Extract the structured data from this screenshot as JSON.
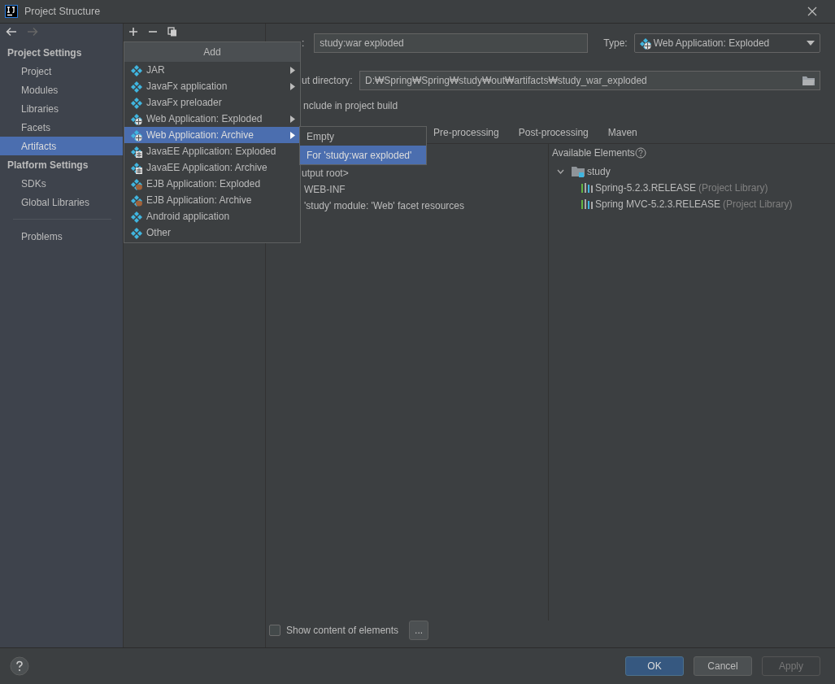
{
  "window": {
    "title": "Project Structure"
  },
  "sidebar": {
    "sections": [
      {
        "title": "Project Settings",
        "items": [
          {
            "label": "Project",
            "selected": false
          },
          {
            "label": "Modules",
            "selected": false
          },
          {
            "label": "Libraries",
            "selected": false
          },
          {
            "label": "Facets",
            "selected": false
          },
          {
            "label": "Artifacts",
            "selected": true
          }
        ]
      },
      {
        "title": "Platform Settings",
        "items": [
          {
            "label": "SDKs",
            "selected": false
          },
          {
            "label": "Global Libraries",
            "selected": false
          }
        ]
      }
    ],
    "bottom_items": [
      {
        "label": "Problems",
        "selected": false
      }
    ]
  },
  "add_menu": {
    "title": "Add",
    "items": [
      {
        "label": "JAR",
        "kind": "module",
        "submenu": true,
        "selected": false
      },
      {
        "label": "JavaFx application",
        "kind": "module",
        "submenu": true,
        "selected": false
      },
      {
        "label": "JavaFx preloader",
        "kind": "module",
        "submenu": false,
        "selected": false
      },
      {
        "label": "Web Application: Exploded",
        "kind": "web",
        "submenu": true,
        "selected": false
      },
      {
        "label": "Web Application: Archive",
        "kind": "web",
        "submenu": true,
        "selected": true
      },
      {
        "label": "JavaEE Application: Exploded",
        "kind": "javaee",
        "submenu": false,
        "selected": false
      },
      {
        "label": "JavaEE Application: Archive",
        "kind": "javaee",
        "submenu": false,
        "selected": false
      },
      {
        "label": "EJB Application: Exploded",
        "kind": "ejb",
        "submenu": false,
        "selected": false
      },
      {
        "label": "EJB Application: Archive",
        "kind": "ejb",
        "submenu": false,
        "selected": false
      },
      {
        "label": "Android application",
        "kind": "module",
        "submenu": false,
        "selected": false
      },
      {
        "label": "Other",
        "kind": "module",
        "submenu": false,
        "selected": false
      }
    ]
  },
  "submenu": {
    "items": [
      {
        "label": "Empty",
        "selected": false
      },
      {
        "label": "For 'study:war exploded'",
        "selected": true
      }
    ]
  },
  "artifact": {
    "name_label": ":",
    "name_value": "study:war exploded",
    "type_label": "Type:",
    "type_value": "Web Application: Exploded",
    "output_label": "ut directory:",
    "output_value": "D:₩Spring₩Spring₩study₩out₩artifacts₩study_war_exploded",
    "include_label": "nclude in project build"
  },
  "tabs": [
    {
      "label": "Pre-processing",
      "selected": false
    },
    {
      "label": "Post-processing",
      "selected": false
    },
    {
      "label": "Maven",
      "selected": false
    }
  ],
  "layout_tree": [
    "utput root>",
    "WEB-INF",
    "'study' module: 'Web' facet resources"
  ],
  "available": {
    "title": "Available Elements",
    "tree": [
      {
        "label": "study",
        "expanded": true,
        "children": [
          {
            "label": "Spring-5.2.3.RELEASE",
            "note": "(Project Library)"
          },
          {
            "label": "Spring MVC-5.2.3.RELEASE",
            "note": "(Project Library)"
          }
        ]
      }
    ]
  },
  "show_content": {
    "label": "Show content of elements",
    "checked": false,
    "button": "..."
  },
  "buttons": [
    {
      "label": "OK",
      "kind": "primary",
      "disabled": false
    },
    {
      "label": "Cancel",
      "kind": "normal",
      "disabled": false
    },
    {
      "label": "Apply",
      "kind": "normal",
      "disabled": true
    }
  ]
}
